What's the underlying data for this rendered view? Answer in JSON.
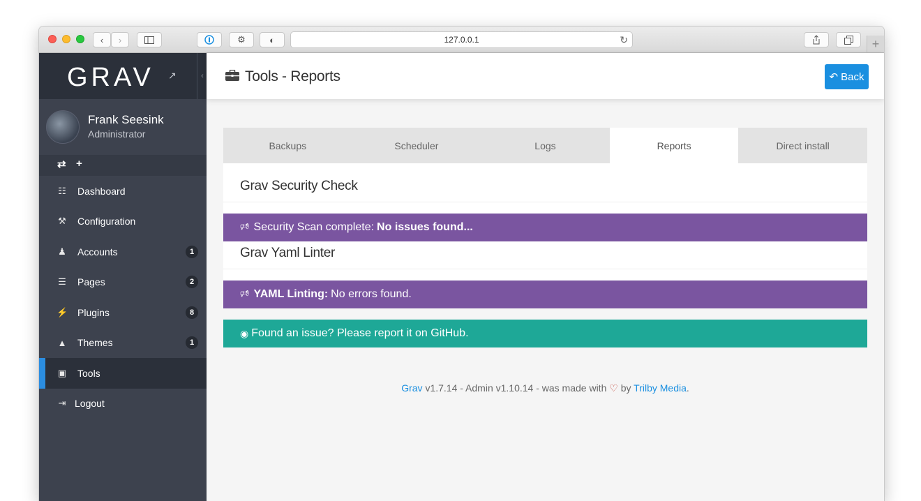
{
  "browser": {
    "url": "127.0.0.1"
  },
  "sidebar": {
    "logo": "GRAV",
    "user": {
      "name": "Frank Seesink",
      "role": "Administrator"
    },
    "items": [
      {
        "label": "Dashboard",
        "icon": "grid-icon",
        "badge": ""
      },
      {
        "label": "Configuration",
        "icon": "wrench-icon",
        "badge": ""
      },
      {
        "label": "Accounts",
        "icon": "users-icon",
        "badge": "1"
      },
      {
        "label": "Pages",
        "icon": "file-icon",
        "badge": "2"
      },
      {
        "label": "Plugins",
        "icon": "plug-icon",
        "badge": "8"
      },
      {
        "label": "Themes",
        "icon": "tint-icon",
        "badge": "1"
      },
      {
        "label": "Tools",
        "icon": "briefcase-icon",
        "badge": ""
      },
      {
        "label": "Logout",
        "icon": "sign-out-icon",
        "badge": ""
      }
    ]
  },
  "header": {
    "title": "Tools - Reports",
    "back_label": "Back"
  },
  "tabs": [
    "Backups",
    "Scheduler",
    "Logs",
    "Reports",
    "Direct install"
  ],
  "active_tab": "Reports",
  "security": {
    "title": "Grav Security Check",
    "msg_prefix": "Security Scan complete:",
    "msg_bold": "No issues found..."
  },
  "yaml": {
    "title": "Grav Yaml Linter",
    "msg_bold": "YAML Linting:",
    "msg_rest": "No errors found."
  },
  "github": {
    "msg": "Found an issue? Please report it on GitHub."
  },
  "footer": {
    "grav_link": "Grav",
    "mid": "v1.7.14 - Admin v1.10.14 - was made with",
    "by": "by",
    "trilby_link": "Trilby Media",
    "end": "."
  },
  "colors": {
    "accent": "#1a8fe0",
    "notice_purple": "#7a55a0",
    "notice_teal": "#1ea897",
    "sidebar_bg": "#3d424e"
  }
}
